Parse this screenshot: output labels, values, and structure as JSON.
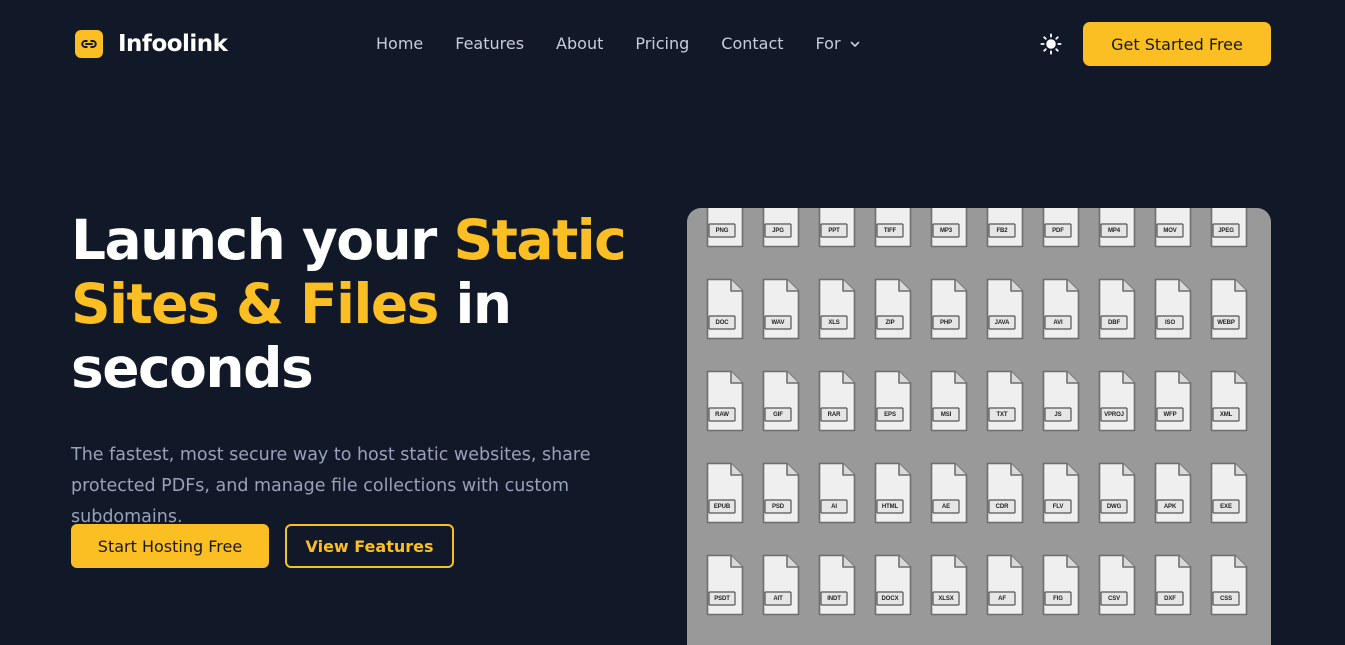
{
  "brand": {
    "name": "Infoolink",
    "accent": "#fbbf24",
    "background": "#111827"
  },
  "nav": {
    "links": [
      "Home",
      "Features",
      "About",
      "Pricing",
      "Contact"
    ],
    "dropdown_label": "For",
    "cta_label": "Get Started Free",
    "theme_icon": "sun-icon"
  },
  "hero": {
    "title_line1_plain": "Launch your ",
    "title_line1_highlight": "Static",
    "title_line2_highlight": "Sites & Files",
    "title_line2_plain": " in",
    "title_line3_plain": "seconds",
    "subtitle": "The fastest, most secure way to host static websites, share protected PDFs, and manage file collections with custom subdomains.",
    "primary_button": "Start Hosting Free",
    "secondary_button": "View Features"
  },
  "file_types": [
    [
      "PNG",
      "JPG",
      "PPT",
      "TIFF",
      "MP3",
      "FB2",
      "PDF",
      "MP4",
      "MOV",
      "JPEG"
    ],
    [
      "DOC",
      "WAV",
      "XLS",
      "ZIP",
      "PHP",
      "JAVA",
      "AVI",
      "DBF",
      "ISO",
      "WEBP"
    ],
    [
      "RAW",
      "GIF",
      "RAR",
      "EPS",
      "MSI",
      "TXT",
      "JS",
      "VPROJ",
      "WFP",
      "XML"
    ],
    [
      "EPUB",
      "PSD",
      "AI",
      "HTML",
      "AE",
      "CDR",
      "FLV",
      "DWG",
      "APK",
      "EXE"
    ],
    [
      "PSDT",
      "AIT",
      "INDT",
      "DOCX",
      "XLSX",
      "AF",
      "FIG",
      "CSV",
      "DXF",
      "CSS"
    ]
  ]
}
